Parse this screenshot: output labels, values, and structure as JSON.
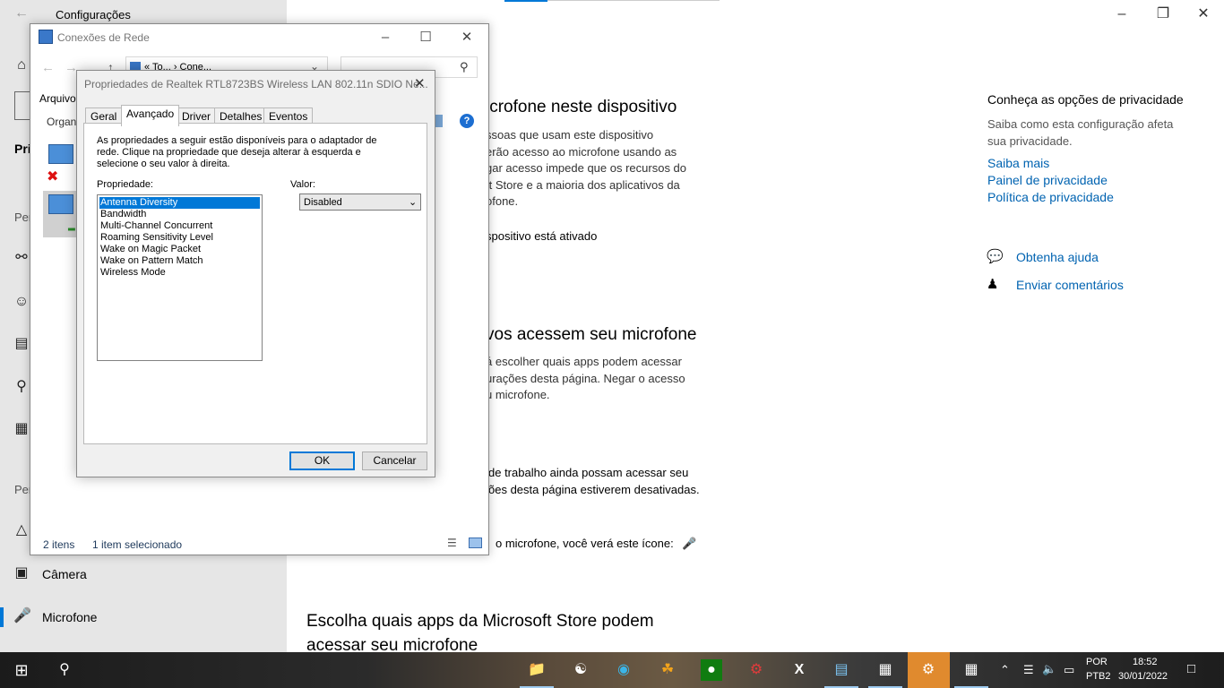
{
  "settings": {
    "title": "Configurações",
    "sidebar": {
      "section_privacy_initial": "Pri",
      "group1_initial": "Per",
      "group2_initial": "Per",
      "items": [
        {
          "label": "Câmera",
          "icon": "camera-icon"
        },
        {
          "label": "Microfone",
          "icon": "microphone-icon"
        }
      ]
    },
    "main": {
      "heading1": "icrofone neste dispositivo",
      "para1": [
        "ssoas que usam este dispositivo",
        "erão acesso ao microfone usando as",
        "gar acesso impede que os recursos do",
        "ft Store e a maioria dos aplicativos da",
        "ofone."
      ],
      "status1": "spositivo está ativado",
      "heading2": "vos acessem seu microfone",
      "para2": [
        "á escolher quais apps podem acessar",
        "urações desta página. Negar o acesso",
        "u microfone."
      ],
      "para3": [
        "de trabalho ainda possam acessar seu",
        "ões desta página estiverem desativadas."
      ],
      "para4": "o microfone, você verá este ícone:",
      "heading3_line1": "Escolha quais apps da Microsoft Store podem",
      "heading3_line2": "acessar seu microfone"
    },
    "right": {
      "privacy_title": "Conheça as opções de privacidade",
      "privacy_desc": [
        "Saiba como esta configuração afeta",
        "sua privacidade."
      ],
      "links": [
        "Saiba mais",
        "Painel de privacidade",
        "Política de privacidade"
      ],
      "help": "Obtenha ajuda",
      "feedback": "Enviar comentários"
    }
  },
  "explorer": {
    "title": "Conexões de Rede",
    "breadcrumb": "«  To...  ›  Cone...",
    "menu_file": "Arquivo",
    "organize": "Organ",
    "status_items": "2 itens",
    "status_selected": "1 item selecionado"
  },
  "dialog": {
    "title": "Propriedades de Realtek RTL8723BS Wireless LAN 802.11n SDIO Ne...",
    "tabs": [
      "Geral",
      "Avançado",
      "Driver",
      "Detalhes",
      "Eventos"
    ],
    "active_tab": "Avançado",
    "description": [
      "As propriedades a seguir estão disponíveis para o adaptador de",
      "rede. Clique na propriedade que deseja alterar à esquerda e",
      "selecione o seu valor à direita."
    ],
    "property_label": "Propriedade:",
    "value_label": "Valor:",
    "properties": [
      "Antenna Diversity",
      "Bandwidth",
      "Multi-Channel Concurrent",
      "Roaming Sensitivity Level",
      "Wake on Magic Packet",
      "Wake on Pattern Match",
      "Wireless Mode"
    ],
    "selected_property": "Antenna Diversity",
    "value": "Disabled",
    "ok": "OK",
    "cancel": "Cancelar"
  },
  "taskbar": {
    "lang1": "POR",
    "lang2": "PTB2",
    "time": "18:52",
    "date": "30/01/2022"
  },
  "colors": {
    "accent": "#0078d7",
    "link": "#0063b1",
    "sidebar_bg": "#e6e6e6",
    "settings_tb_highlight": "#e08a2e"
  }
}
